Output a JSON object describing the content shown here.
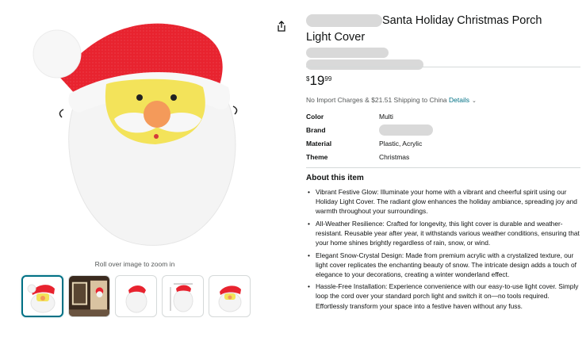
{
  "gallery": {
    "zoom_hint": "Roll over image to zoom in",
    "thumbnails": [
      {
        "name": "santa-front"
      },
      {
        "name": "porch-scene"
      },
      {
        "name": "santa-side"
      },
      {
        "name": "santa-dimensions"
      },
      {
        "name": "santa-angle"
      }
    ]
  },
  "product": {
    "title_line1": "Santa Holiday Christmas Porch",
    "title_line2": "Light Cover"
  },
  "price": {
    "symbol": "$",
    "whole": "19",
    "fraction": "99"
  },
  "shipping": {
    "text": "No Import Charges & $21.51 Shipping to China",
    "details_link": "Details",
    "caret": "⌄"
  },
  "specs": [
    {
      "key": "Color",
      "value": "Multi"
    },
    {
      "key": "Brand",
      "value": ""
    },
    {
      "key": "Material",
      "value": "Plastic, Acrylic"
    },
    {
      "key": "Theme",
      "value": "Christmas"
    }
  ],
  "about": {
    "heading": "About this item",
    "bullets": [
      "Vibrant Festive Glow: Illuminate your home with a vibrant and cheerful spirit using our Holiday Light Cover. The radiant glow enhances the holiday ambiance, spreading joy and warmth throughout your surroundings.",
      "All-Weather Resilience: Crafted for longevity, this light cover is durable and weather-resistant. Reusable year after year, it withstands various weather conditions, ensuring that your home shines brightly regardless of rain, snow, or wind.",
      "Elegant Snow-Crystal Design: Made from premium acrylic with a crystalized texture, our light cover replicates the enchanting beauty of snow. The intricate design adds a touch of elegance to your decorations, creating a winter wonderland effect.",
      "Hassle-Free Installation: Experience convenience with our easy-to-use light cover. Simply loop the cord over your standard porch light and switch it on—no tools required. Effortlessly transform your space into a festive haven without any fuss."
    ]
  },
  "icons": {
    "share": "share-icon"
  },
  "colors": {
    "link": "#007185",
    "santa_red": "#e8232f",
    "santa_face": "#f3e35a",
    "nose": "#f49a5a",
    "redacted": "#d9d9d9"
  }
}
